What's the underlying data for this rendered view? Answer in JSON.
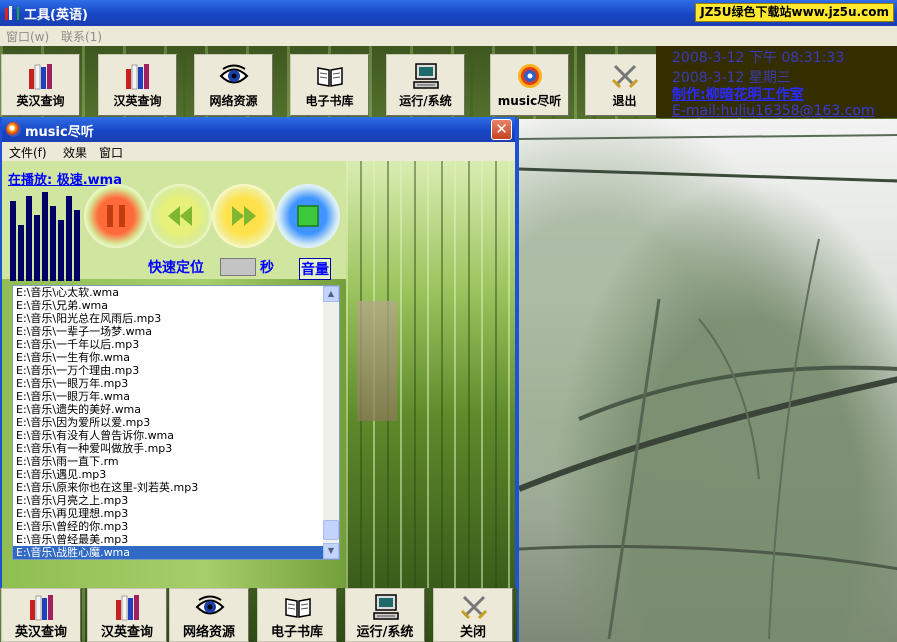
{
  "app": {
    "title": "工具(英语)",
    "badge": "JZ5U绿色下载站www.jz5u.com"
  },
  "menu": {
    "window": "窗口(w)",
    "contact": "联系(1)"
  },
  "toolbar": [
    {
      "label": "英汉查询",
      "icon": "books-icon"
    },
    {
      "label": "汉英查询",
      "icon": "books-icon"
    },
    {
      "label": "网络资源",
      "icon": "eye-icon"
    },
    {
      "label": "电子书库",
      "icon": "open-book-icon"
    },
    {
      "label": "运行/系统",
      "icon": "computer-icon"
    },
    {
      "label": "music尽听",
      "icon": "music-disc-icon"
    },
    {
      "label": "退出",
      "icon": "crossed-swords-icon"
    }
  ],
  "info": {
    "date1": "2008-3-12  下午  08:31:33",
    "date2": "2008-3-12     星期三",
    "maker": "制作:柳暗花明工作室",
    "email": "E-mail:huliu16358@163.com"
  },
  "music_window": {
    "title": "music尽听",
    "close": "✕",
    "menu": {
      "file": "文件(f)",
      "effects": "效果",
      "window": "窗口"
    },
    "now_playing": "在播放: 极速.wma",
    "spectrum_levels": [
      0.85,
      0.6,
      0.9,
      0.7,
      0.95,
      0.8,
      0.65,
      0.9,
      0.75
    ],
    "seek_label": "快速定位",
    "seek_unit": "秒",
    "volume_label": "音量",
    "playlist": [
      "E:\\音乐\\心太软.wma",
      "E:\\音乐\\兄弟.wma",
      "E:\\音乐\\阳光总在风雨后.mp3",
      "E:\\音乐\\一辈子一场梦.wma",
      "E:\\音乐\\一千年以后.mp3",
      "E:\\音乐\\一生有你.wma",
      "E:\\音乐\\一万个理由.mp3",
      "E:\\音乐\\一眼万年.mp3",
      "E:\\音乐\\一眼万年.wma",
      "E:\\音乐\\遗失的美好.wma",
      "E:\\音乐\\因为爱所以爱.mp3",
      "E:\\音乐\\有没有人曾告诉你.wma",
      "E:\\音乐\\有一种爱叫做放手.mp3",
      "E:\\音乐\\雨一直下.rm",
      "E:\\音乐\\遇见.mp3",
      "E:\\音乐\\原来你也在这里-刘若英.mp3",
      "E:\\音乐\\月亮之上.mp3",
      "E:\\音乐\\再见理想.mp3",
      "E:\\音乐\\曾经的你.mp3",
      "E:\\音乐\\曾经最美.mp3",
      "E:\\音乐\\战胜心魔.wma"
    ],
    "selected_index": 20
  },
  "bottom_toolbar": [
    {
      "label": "英汉查询",
      "icon": "books-icon"
    },
    {
      "label": "汉英查询",
      "icon": "books-icon"
    },
    {
      "label": "网络资源",
      "icon": "eye-icon"
    },
    {
      "label": "电子书库",
      "icon": "open-book-icon"
    },
    {
      "label": "运行/系统",
      "icon": "computer-icon"
    },
    {
      "label": "关闭",
      "icon": "crossed-swords-icon"
    }
  ],
  "colors": {
    "title_bar": "#1746c4",
    "accent_text": "#0000ff",
    "selection": "#316ac5",
    "button_face": "#ece9d8"
  }
}
